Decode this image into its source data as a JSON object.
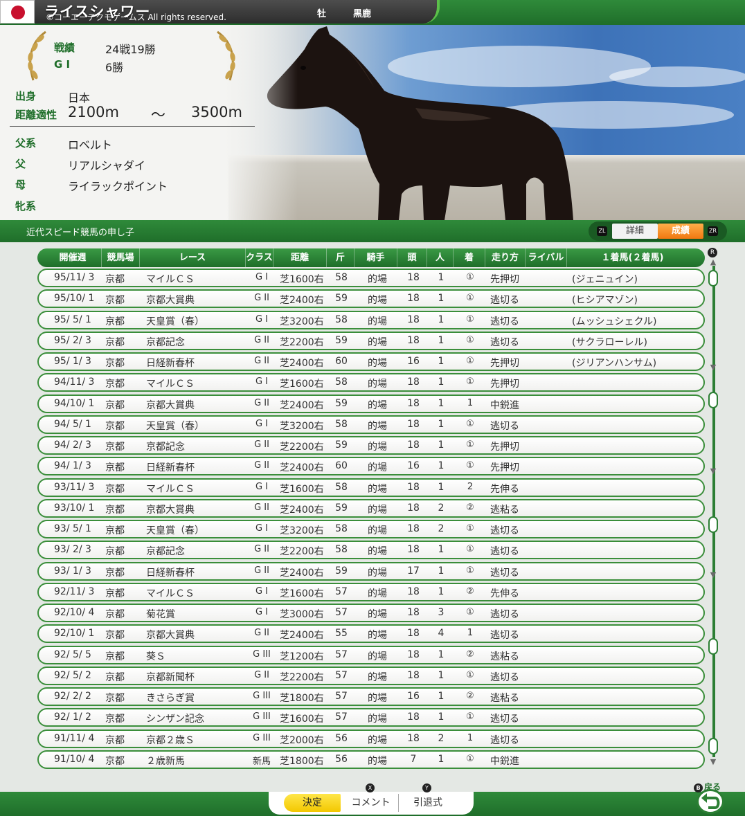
{
  "header": {
    "horse_name": "ライスシャワー",
    "copyright": "©コーエーテクモゲームス All rights reserved.",
    "sex": "牡",
    "coat": "黒鹿"
  },
  "profile": {
    "record_label": "戦績",
    "record_value": "24戦19勝",
    "g1_label": "G I",
    "g1_value": "6勝",
    "origin_label": "出身",
    "origin_value": "日本",
    "distance_label": "距離適性",
    "distance_min": "2100m",
    "distance_sep": "～",
    "distance_max": "3500m",
    "sire_line_label": "父系",
    "sire_line_value": "ロベルト",
    "sire_label": "父",
    "sire_value": "リアルシャダイ",
    "dam_label": "母",
    "dam_value": "ライラックポイント",
    "female_line_label": "牝系",
    "female_line_value": ""
  },
  "subbar": {
    "subtitle": "近代スピード競馬の申し子",
    "tab_left_key": "ZL",
    "tab_detail": "詳細",
    "tab_record": "成績",
    "tab_right_key": "ZR"
  },
  "table": {
    "headers": [
      "開催週",
      "競馬場",
      "レース",
      "クラス",
      "距離",
      "斤",
      "騎手",
      "頭",
      "人",
      "着",
      "走り方",
      "ライバル",
      "１着馬(２着馬)"
    ],
    "rows": [
      {
        "date": "95/11/ 3",
        "course": "京都",
        "race": "マイルＣＳ",
        "class": "G I",
        "dist": "芝1600右",
        "kin": "58",
        "jockey": "的場",
        "heads": "18",
        "pop": "1",
        "finish": "①",
        "style": "先押切",
        "winner": "(ジェニュイン)"
      },
      {
        "date": "95/10/ 1",
        "course": "京都",
        "race": "京都大賞典",
        "class": "G II",
        "dist": "芝2400右",
        "kin": "59",
        "jockey": "的場",
        "heads": "18",
        "pop": "1",
        "finish": "①",
        "style": "逃切る",
        "winner": "(ヒシアマゾン)"
      },
      {
        "date": "95/ 5/ 1",
        "course": "京都",
        "race": "天皇賞（春）",
        "class": "G I",
        "dist": "芝3200右",
        "kin": "58",
        "jockey": "的場",
        "heads": "18",
        "pop": "1",
        "finish": "①",
        "style": "逃切る",
        "winner": "(ムッシュシェクル)"
      },
      {
        "date": "95/ 2/ 3",
        "course": "京都",
        "race": "京都記念",
        "class": "G II",
        "dist": "芝2200右",
        "kin": "59",
        "jockey": "的場",
        "heads": "18",
        "pop": "1",
        "finish": "①",
        "style": "逃切る",
        "winner": "(サクラローレル)"
      },
      {
        "date": "95/ 1/ 3",
        "course": "京都",
        "race": "日経新春杯",
        "class": "G II",
        "dist": "芝2400右",
        "kin": "60",
        "jockey": "的場",
        "heads": "16",
        "pop": "1",
        "finish": "①",
        "style": "先押切",
        "winner": "(ジリアンハンサム)"
      },
      {
        "date": "94/11/ 3",
        "course": "京都",
        "race": "マイルＣＳ",
        "class": "G I",
        "dist": "芝1600右",
        "kin": "58",
        "jockey": "的場",
        "heads": "18",
        "pop": "1",
        "finish": "①",
        "style": "先押切",
        "winner": ""
      },
      {
        "date": "94/10/ 1",
        "course": "京都",
        "race": "京都大賞典",
        "class": "G II",
        "dist": "芝2400右",
        "kin": "59",
        "jockey": "的場",
        "heads": "18",
        "pop": "1",
        "finish": "1",
        "style": "中鋭進",
        "winner": ""
      },
      {
        "date": "94/ 5/ 1",
        "course": "京都",
        "race": "天皇賞（春）",
        "class": "G I",
        "dist": "芝3200右",
        "kin": "58",
        "jockey": "的場",
        "heads": "18",
        "pop": "1",
        "finish": "①",
        "style": "逃切る",
        "winner": ""
      },
      {
        "date": "94/ 2/ 3",
        "course": "京都",
        "race": "京都記念",
        "class": "G II",
        "dist": "芝2200右",
        "kin": "59",
        "jockey": "的場",
        "heads": "18",
        "pop": "1",
        "finish": "①",
        "style": "先押切",
        "winner": ""
      },
      {
        "date": "94/ 1/ 3",
        "course": "京都",
        "race": "日経新春杯",
        "class": "G II",
        "dist": "芝2400右",
        "kin": "60",
        "jockey": "的場",
        "heads": "16",
        "pop": "1",
        "finish": "①",
        "style": "先押切",
        "winner": ""
      },
      {
        "date": "93/11/ 3",
        "course": "京都",
        "race": "マイルＣＳ",
        "class": "G I",
        "dist": "芝1600右",
        "kin": "58",
        "jockey": "的場",
        "heads": "18",
        "pop": "1",
        "finish": "2",
        "style": "先伸る",
        "winner": ""
      },
      {
        "date": "93/10/ 1",
        "course": "京都",
        "race": "京都大賞典",
        "class": "G II",
        "dist": "芝2400右",
        "kin": "59",
        "jockey": "的場",
        "heads": "18",
        "pop": "2",
        "finish": "②",
        "style": "逃粘る",
        "winner": ""
      },
      {
        "date": "93/ 5/ 1",
        "course": "京都",
        "race": "天皇賞（春）",
        "class": "G I",
        "dist": "芝3200右",
        "kin": "58",
        "jockey": "的場",
        "heads": "18",
        "pop": "2",
        "finish": "①",
        "style": "逃切る",
        "winner": ""
      },
      {
        "date": "93/ 2/ 3",
        "course": "京都",
        "race": "京都記念",
        "class": "G II",
        "dist": "芝2200右",
        "kin": "58",
        "jockey": "的場",
        "heads": "18",
        "pop": "1",
        "finish": "①",
        "style": "逃切る",
        "winner": ""
      },
      {
        "date": "93/ 1/ 3",
        "course": "京都",
        "race": "日経新春杯",
        "class": "G II",
        "dist": "芝2400右",
        "kin": "59",
        "jockey": "的場",
        "heads": "17",
        "pop": "1",
        "finish": "①",
        "style": "逃切る",
        "winner": ""
      },
      {
        "date": "92/11/ 3",
        "course": "京都",
        "race": "マイルＣＳ",
        "class": "G I",
        "dist": "芝1600右",
        "kin": "57",
        "jockey": "的場",
        "heads": "18",
        "pop": "1",
        "finish": "②",
        "style": "先伸る",
        "winner": ""
      },
      {
        "date": "92/10/ 4",
        "course": "京都",
        "race": "菊花賞",
        "class": "G I",
        "dist": "芝3000右",
        "kin": "57",
        "jockey": "的場",
        "heads": "18",
        "pop": "3",
        "finish": "①",
        "style": "逃切る",
        "winner": ""
      },
      {
        "date": "92/10/ 1",
        "course": "京都",
        "race": "京都大賞典",
        "class": "G II",
        "dist": "芝2400右",
        "kin": "55",
        "jockey": "的場",
        "heads": "18",
        "pop": "4",
        "finish": "1",
        "style": "逃切る",
        "winner": ""
      },
      {
        "date": "92/ 5/ 5",
        "course": "京都",
        "race": "葵Ｓ",
        "class": "G III",
        "dist": "芝1200右",
        "kin": "57",
        "jockey": "的場",
        "heads": "18",
        "pop": "1",
        "finish": "②",
        "style": "逃粘る",
        "winner": ""
      },
      {
        "date": "92/ 5/ 2",
        "course": "京都",
        "race": "京都新聞杯",
        "class": "G II",
        "dist": "芝2200右",
        "kin": "57",
        "jockey": "的場",
        "heads": "18",
        "pop": "1",
        "finish": "①",
        "style": "逃切る",
        "winner": ""
      },
      {
        "date": "92/ 2/ 2",
        "course": "京都",
        "race": "きさらぎ賞",
        "class": "G III",
        "dist": "芝1800右",
        "kin": "57",
        "jockey": "的場",
        "heads": "16",
        "pop": "1",
        "finish": "②",
        "style": "逃粘る",
        "winner": ""
      },
      {
        "date": "92/ 1/ 2",
        "course": "京都",
        "race": "シンザン記念",
        "class": "G III",
        "dist": "芝1600右",
        "kin": "57",
        "jockey": "的場",
        "heads": "18",
        "pop": "1",
        "finish": "①",
        "style": "逃切る",
        "winner": ""
      },
      {
        "date": "91/11/ 4",
        "course": "京都",
        "race": "京都２歳Ｓ",
        "class": "G III",
        "dist": "芝2000右",
        "kin": "56",
        "jockey": "的場",
        "heads": "18",
        "pop": "2",
        "finish": "1",
        "style": "逃切る",
        "winner": ""
      },
      {
        "date": "91/10/ 4",
        "course": "京都",
        "race": "２歳新馬",
        "class": "新馬",
        "dist": "芝1800右",
        "kin": "56",
        "jockey": "的場",
        "heads": "7",
        "pop": "1",
        "finish": "①",
        "style": "中鋭進",
        "winner": ""
      }
    ]
  },
  "scroll": {
    "r_key": "R"
  },
  "footer": {
    "ok_label": "決定",
    "comment_label": "コメント",
    "comment_key": "X",
    "retire_label": "引退式",
    "retire_key": "Y",
    "back_label": "戻る",
    "back_key": "B"
  },
  "colors": {
    "accent_green": "#2f8a3a",
    "row_border": "#3a8e3a",
    "tab_active": "#f07810",
    "ok_button": "#f3c800"
  }
}
